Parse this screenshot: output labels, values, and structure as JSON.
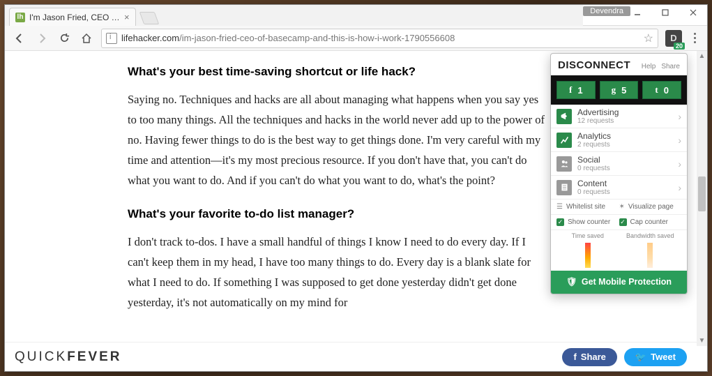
{
  "window": {
    "user_badge": "Devendra"
  },
  "tab": {
    "title": "I'm Jason Fried, CEO of B",
    "favicon_letter": "lh"
  },
  "url": {
    "host": "lifehacker.com",
    "path": "/im-jason-fried-ceo-of-basecamp-and-this-is-how-i-work-1790556608"
  },
  "extension": {
    "letter": "D",
    "badge": "20"
  },
  "article": {
    "h1": "What's your best time-saving shortcut or life hack?",
    "p1": "Saying no. Techniques and hacks are all about managing what happens when you say yes to too many things. All the techniques and hacks in the world never add up to the power of no. Having fewer things to do is the best way to get things done. I'm very careful with my time and attention—it's my most precious resource. If you don't have that, you can't do what you want to do. And if you can't do what you want to do, what's the point?",
    "h2": "What's your favorite to-do list manager?",
    "p2": "I don't track to-dos. I have a small handful of things I know I need to do every day. If I can't keep them in my head, I have too many things to do. Every day is a blank slate for what I need to do. If something I was supposed to get done yesterday didn't get done yesterday, it's not automatically on my mind for"
  },
  "bottom": {
    "brand_a": "QUICK",
    "brand_b": "FEVER",
    "share": "Share",
    "tweet": "Tweet"
  },
  "popup": {
    "title": "DISCONNECT",
    "help": "Help",
    "share": "Share",
    "social": [
      {
        "icon": "f",
        "count": "1"
      },
      {
        "icon": "g",
        "count": "5"
      },
      {
        "icon": "t",
        "count": "0"
      }
    ],
    "categories": [
      {
        "name": "Advertising",
        "reqs": "12 requests",
        "color": "green",
        "glyph": "📢"
      },
      {
        "name": "Analytics",
        "reqs": "2 requests",
        "color": "green",
        "glyph": "📈"
      },
      {
        "name": "Social",
        "reqs": "0 requests",
        "color": "gray",
        "glyph": "👥"
      },
      {
        "name": "Content",
        "reqs": "0 requests",
        "color": "gray",
        "glyph": "📄"
      }
    ],
    "whitelist": "Whitelist site",
    "visualize": "Visualize page",
    "showcounter": "Show counter",
    "capcounter": "Cap counter",
    "timesaved": "Time saved",
    "bwsaved": "Bandwidth saved",
    "mobile": "Get Mobile Protection"
  }
}
